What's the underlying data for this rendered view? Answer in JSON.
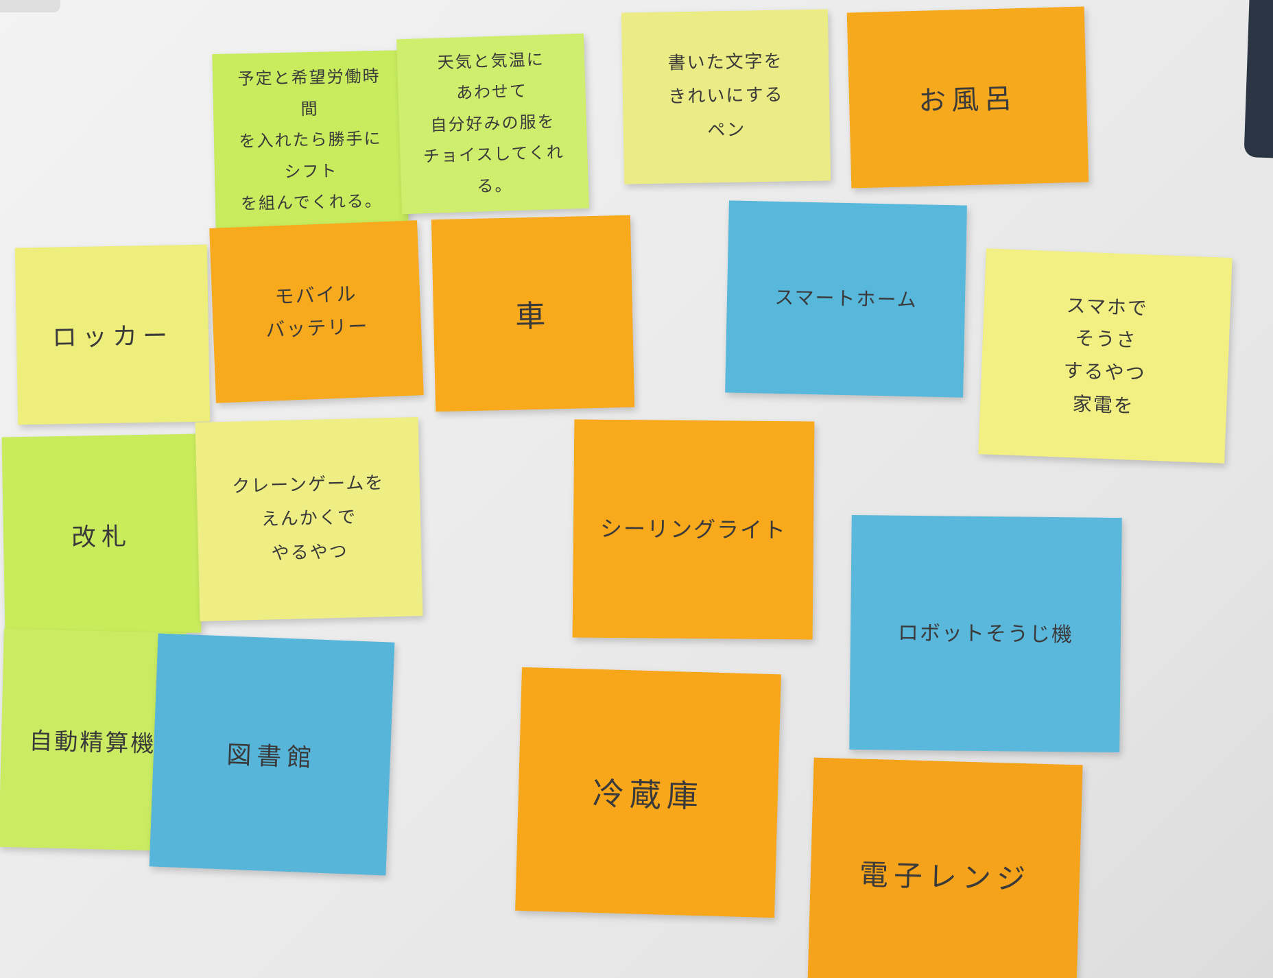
{
  "notes": [
    {
      "id": "shift",
      "text": "予定と希望労働時間\nを入れたら勝手にシフト\nを組んでくれる。",
      "color": "#c8ec5e"
    },
    {
      "id": "weather",
      "text": "天気と気温に\nあわせて\n自分好みの服を\nチョイスしてくれる。",
      "color": "#d0ee6e"
    },
    {
      "id": "pen",
      "text": "書いた文字を\nきれいにする\nペン",
      "color": "#ecec86"
    },
    {
      "id": "bath",
      "text": "お風呂",
      "color": "#f7a91d"
    },
    {
      "id": "locker",
      "text": "ロッカー",
      "color": "#eeee7c"
    },
    {
      "id": "battery",
      "text": "モバイル\nバッテリー",
      "color": "#f8aa1f"
    },
    {
      "id": "car",
      "text": "車",
      "color": "#f8a91c"
    },
    {
      "id": "smarthome",
      "text": "スマートホーム",
      "color": "#58b8dc"
    },
    {
      "id": "phone",
      "text": "スマホで\nそうさ\nするやつ\n家電を",
      "color": "#f2f082"
    },
    {
      "id": "ticket",
      "text": "改札",
      "color": "#c9ec5c"
    },
    {
      "id": "crane",
      "text": "クレーンゲームを\nえんかくで\nやるやつ",
      "color": "#eeee84"
    },
    {
      "id": "ceiling",
      "text": "シーリングライト",
      "color": "#f8a91c"
    },
    {
      "id": "robot",
      "text": "ロボットそうじ機",
      "color": "#5ab8dc"
    },
    {
      "id": "checkout",
      "text": "自動精算機",
      "color": "#cbec62"
    },
    {
      "id": "library",
      "text": "図書館",
      "color": "#58b5da"
    },
    {
      "id": "fridge",
      "text": "冷蔵庫",
      "color": "#f8a71b"
    },
    {
      "id": "microwave",
      "text": "電子レンジ",
      "color": "#f5a31a"
    }
  ]
}
